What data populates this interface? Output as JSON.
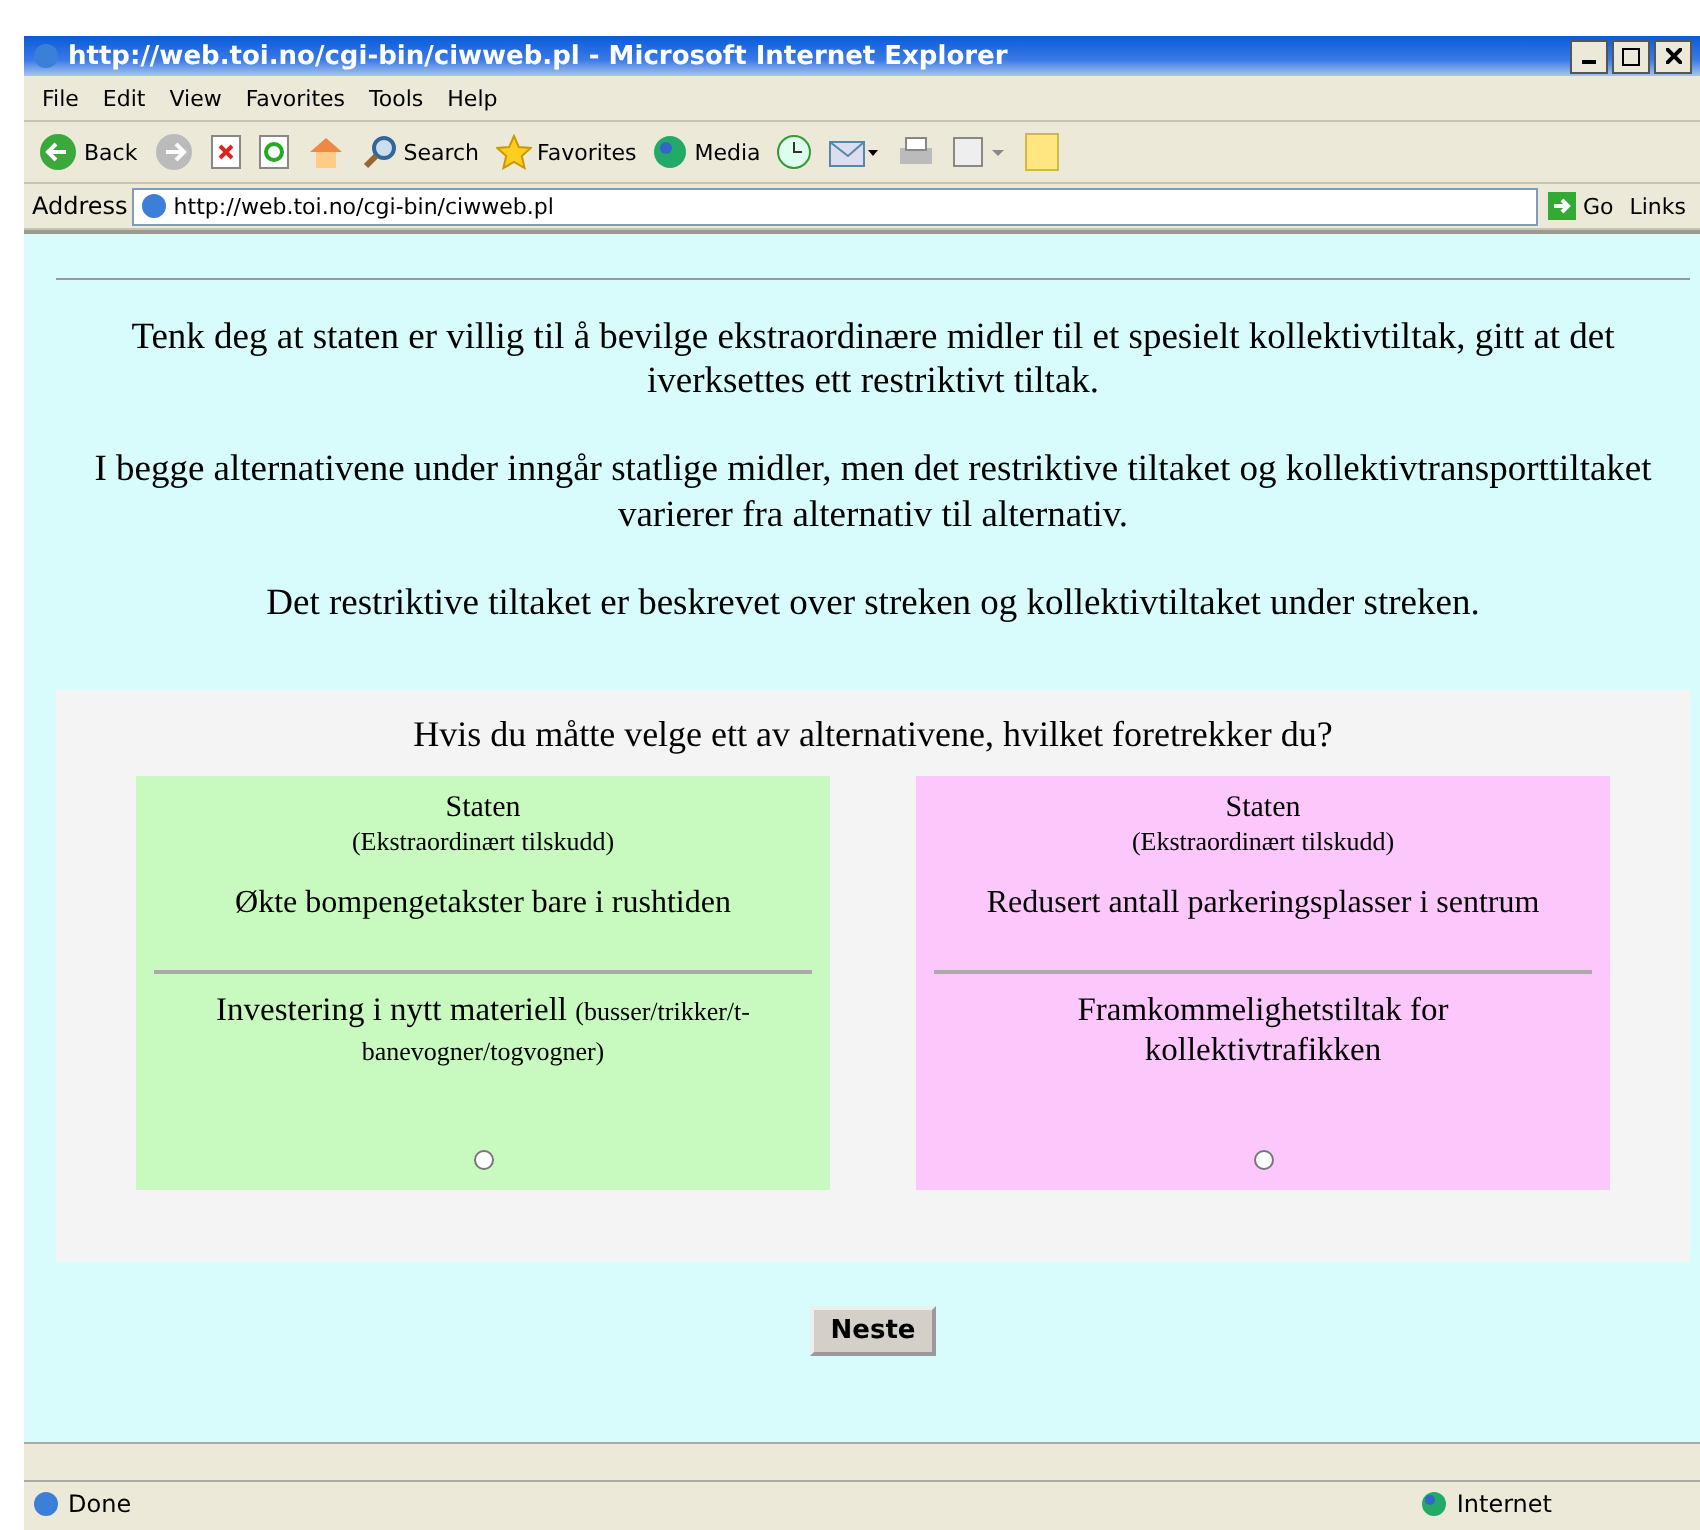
{
  "window": {
    "title": "http://web.toi.no/cgi-bin/ciwweb.pl - Microsoft Internet Explorer"
  },
  "menu": [
    "File",
    "Edit",
    "View",
    "Favorites",
    "Tools",
    "Help"
  ],
  "toolbar": [
    {
      "kind": "back",
      "label": "Back"
    },
    {
      "kind": "forward"
    },
    {
      "kind": "stop"
    },
    {
      "kind": "refresh"
    },
    {
      "kind": "home"
    },
    {
      "kind": "search",
      "label": "Search"
    },
    {
      "kind": "favorites",
      "label": "Favorites"
    },
    {
      "kind": "media",
      "label": "Media"
    },
    {
      "kind": "history"
    },
    {
      "kind": "mail"
    },
    {
      "kind": "print"
    },
    {
      "kind": "edit"
    },
    {
      "kind": "note"
    }
  ],
  "address": {
    "label": "Address",
    "value": "http://web.toi.no/cgi-bin/ciwweb.pl",
    "go": "Go",
    "links": "Links"
  },
  "intro": [
    "Tenk deg at staten er villig til å bevilge ekstraordinære midler til et spesielt kollektivtiltak, gitt at det iverksettes ett restriktivt tiltak.",
    "I begge alternativene under inngår statlige midler, men det restriktive tiltaket og kollektivtransporttiltaket varierer fra alternativ til alternativ.",
    "Det restriktive tiltaket er beskrevet over streken og kollektivtiltaket under streken."
  ],
  "question": "Hvis du måtte velge ett av alternativene, hvilket foretrekker du?",
  "alternatives": [
    {
      "color": "#c8fac0",
      "title": "Staten",
      "subtitle": "(Ekstraordinært tilskudd)",
      "restrictive": "Økte bompengetakster bare i rushtiden",
      "transit": "Investering i nytt materiell",
      "transit_note": "(busser/trikker/t-banevogner/togvogner)",
      "selected": false
    },
    {
      "color": "#fcc8fc",
      "title": "Staten",
      "subtitle": "(Ekstraordinært tilskudd)",
      "restrictive": "Redusert antall parkeringsplasser i sentrum",
      "transit": "Framkommelighetstiltak for kollektivtrafikken",
      "selected": false
    }
  ],
  "next_button": "Neste",
  "status_bar": {
    "text": "Done",
    "zone": "Internet"
  }
}
